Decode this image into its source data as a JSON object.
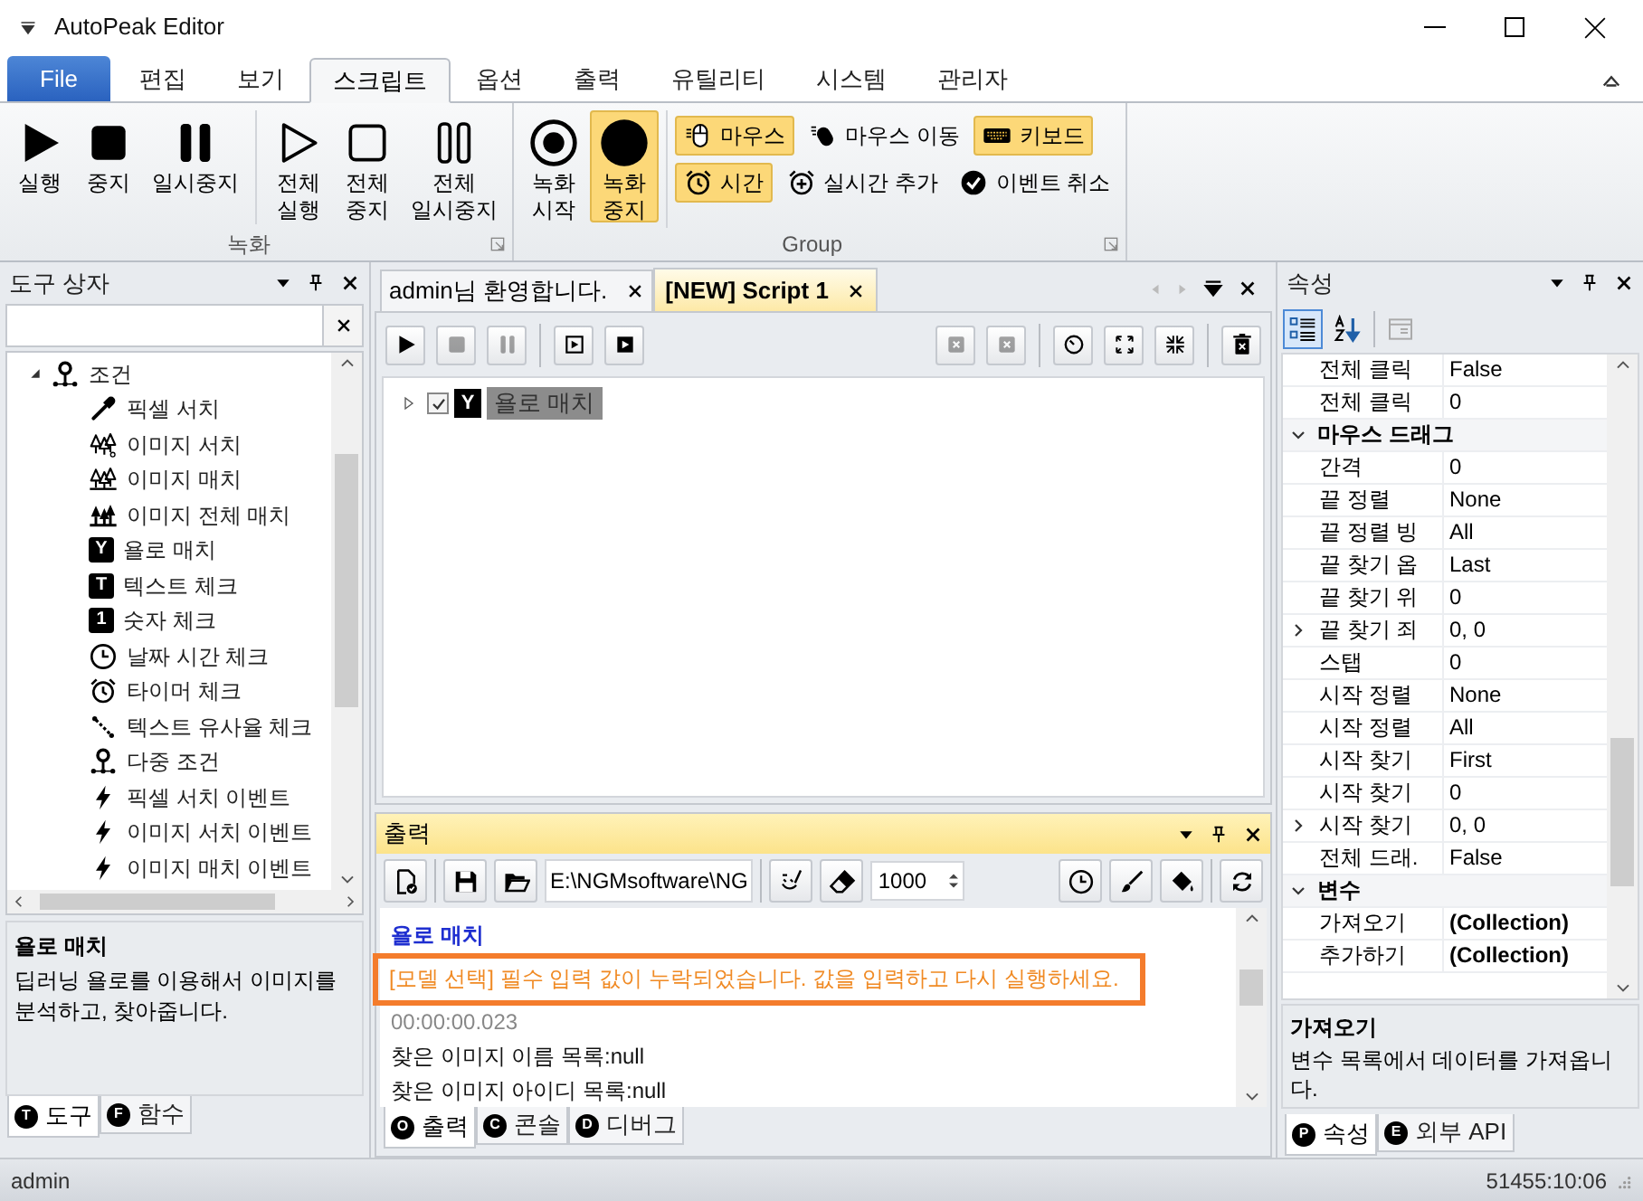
{
  "window": {
    "title": "AutoPeak Editor"
  },
  "menu_tabs": [
    {
      "label": "File",
      "kind": "file",
      "selected": false
    },
    {
      "label": "편집",
      "kind": "tab",
      "selected": false
    },
    {
      "label": "보기",
      "kind": "tab",
      "selected": false
    },
    {
      "label": "스크립트",
      "kind": "tab",
      "selected": true
    },
    {
      "label": "옵션",
      "kind": "tab",
      "selected": false
    },
    {
      "label": "출력",
      "kind": "tab",
      "selected": false
    },
    {
      "label": "유틸리티",
      "kind": "tab",
      "selected": false
    },
    {
      "label": "시스템",
      "kind": "tab",
      "selected": false
    },
    {
      "label": "관리자",
      "kind": "tab",
      "selected": false
    }
  ],
  "ribbon": {
    "groups": [
      {
        "title": "녹화",
        "big_buttons": [
          {
            "label": "실행",
            "kind": "play",
            "selected": false
          },
          {
            "label": "중지",
            "kind": "stop",
            "selected": false
          },
          {
            "label": "일시중지",
            "kind": "pause",
            "selected": false
          },
          {
            "label": "전체\n실행",
            "kind": "play-outline",
            "selected": false
          },
          {
            "label": "전체\n중지",
            "kind": "stop-outline",
            "selected": false
          },
          {
            "label": "전체\n일시중지",
            "kind": "pause-outline",
            "selected": false
          }
        ]
      },
      {
        "title": "Group",
        "big_buttons": [
          {
            "label": "녹화\n시작",
            "kind": "record",
            "selected": false
          },
          {
            "label": "녹화\n중지",
            "kind": "dot",
            "selected": true
          }
        ],
        "small_buttons": [
          {
            "label": "마우스",
            "kind": "mouse",
            "selected": true
          },
          {
            "label": "마우스 이동",
            "kind": "mouse-move",
            "selected": false
          },
          {
            "label": "키보드",
            "kind": "keyboard",
            "selected": true
          },
          {
            "label": "시간",
            "kind": "alarm",
            "selected": true
          },
          {
            "label": "실시간 추가",
            "kind": "alarm-plus",
            "selected": false
          },
          {
            "label": "이벤트 취소",
            "kind": "check",
            "selected": false
          }
        ]
      }
    ]
  },
  "toolbox": {
    "title": "도구 상자",
    "tree": [
      {
        "label": "조건",
        "kind": "pin",
        "expanded": true,
        "children": [
          {
            "label": "픽셀 서치",
            "kind": "dropper"
          },
          {
            "label": "이미지 서치",
            "kind": "trees"
          },
          {
            "label": "이미지 매치",
            "kind": "trees-base"
          },
          {
            "label": "이미지 전체 매치",
            "kind": "trees-fill"
          },
          {
            "label": "욜로 매치",
            "kind": "badge",
            "badge": "Y"
          },
          {
            "label": "텍스트 체크",
            "kind": "badge",
            "badge": "T"
          },
          {
            "label": "숫자 체크",
            "kind": "badge",
            "badge": "1"
          },
          {
            "label": "날짜 시간 체크",
            "kind": "clock"
          },
          {
            "label": "타이머 체크",
            "kind": "alarm"
          },
          {
            "label": "텍스트 유사율 체크",
            "kind": "similar"
          },
          {
            "label": "다중 조건",
            "kind": "pin"
          },
          {
            "label": "픽셀 서치 이벤트",
            "kind": "bolt"
          },
          {
            "label": "이미지 서치 이벤트",
            "kind": "bolt"
          },
          {
            "label": "이미지 매치 이벤트",
            "kind": "bolt"
          }
        ]
      }
    ],
    "description": {
      "title": "욜로 매치",
      "text": "딥러닝 욜로를 이용해서 이미지를 분석하고, 찾아줍니다."
    },
    "tabs": [
      {
        "label": "도구",
        "badge": "T",
        "selected": true
      },
      {
        "label": "함수",
        "badge": "F",
        "selected": false
      }
    ]
  },
  "documents": {
    "tabs": [
      {
        "label": "admin님 환영합니다.",
        "selected": false
      },
      {
        "label": "[NEW] Script 1",
        "selected": true
      }
    ],
    "toolbar": [
      [
        {
          "kind": "play",
          "disabled": false
        },
        {
          "kind": "stop",
          "disabled": true
        },
        {
          "kind": "pause",
          "disabled": true
        }
      ],
      [
        {
          "kind": "step",
          "disabled": false
        },
        {
          "kind": "run-box",
          "disabled": false
        }
      ],
      [
        {
          "kind": "remove",
          "disabled": true
        },
        {
          "kind": "remove",
          "disabled": true
        }
      ],
      [
        {
          "kind": "reset",
          "disabled": false
        },
        {
          "kind": "expand",
          "disabled": false
        },
        {
          "kind": "collapse",
          "disabled": false
        }
      ],
      [
        {
          "kind": "delete",
          "disabled": false
        }
      ]
    ],
    "script": [
      {
        "label": "욜로 매치",
        "badge": "Y",
        "checked": true,
        "expanded": false,
        "selected": true
      }
    ]
  },
  "output": {
    "title": "출력",
    "path": "E:\\NGMsoftware\\NG",
    "limit": "1000",
    "lines": [
      {
        "text": "욜로 매치",
        "kind": "info",
        "highlighted": false
      },
      {
        "text": "[모델 선택] 필수 입력 값이 누락되었습니다. 값을 입력하고 다시 실행하세요.",
        "kind": "error",
        "highlighted": true
      },
      {
        "text": "00:00:00.023",
        "kind": "time",
        "highlighted": false
      },
      {
        "text": "찾은 이미지 이름 목록:null",
        "kind": "plain",
        "highlighted": false
      },
      {
        "text": "찾은 이미지 아이디 목록:null",
        "kind": "plain",
        "highlighted": false
      }
    ],
    "tabs": [
      {
        "label": "출력",
        "badge": "O",
        "selected": true
      },
      {
        "label": "콘솔",
        "badge": "C",
        "selected": false
      },
      {
        "label": "디버그",
        "badge": "D",
        "selected": false
      }
    ]
  },
  "properties": {
    "title": "속성",
    "toolbar": [
      {
        "kind": "categorized",
        "selected": true
      },
      {
        "kind": "alphabetical",
        "selected": false
      },
      {
        "kind": "pages",
        "selected": false
      }
    ],
    "rows": [
      {
        "kind": "property",
        "name": "전체 클릭",
        "value": "False"
      },
      {
        "kind": "property",
        "name": "전체 클릭",
        "value": "0"
      },
      {
        "kind": "category",
        "name": "마우스 드래그",
        "expanded": true
      },
      {
        "kind": "property",
        "name": "간격",
        "value": "0"
      },
      {
        "kind": "property",
        "name": "끝 정렬",
        "value": "None"
      },
      {
        "kind": "property",
        "name": "끝 정렬 빙",
        "value": "All"
      },
      {
        "kind": "property",
        "name": "끝 찾기 옵",
        "value": "Last"
      },
      {
        "kind": "property",
        "name": "끝 찾기 위",
        "value": "0"
      },
      {
        "kind": "property",
        "name": "끝 찾기 죄",
        "value": "0, 0",
        "expanded": false
      },
      {
        "kind": "property",
        "name": "스탭",
        "value": "0"
      },
      {
        "kind": "property",
        "name": "시작 정렬",
        "value": "None"
      },
      {
        "kind": "property",
        "name": "시작 정렬",
        "value": "All"
      },
      {
        "kind": "property",
        "name": "시작 찾기",
        "value": "First"
      },
      {
        "kind": "property",
        "name": "시작 찾기",
        "value": "0"
      },
      {
        "kind": "property",
        "name": "시작 찾기",
        "value": "0, 0",
        "expanded": false
      },
      {
        "kind": "property",
        "name": "전체 드래.",
        "value": "False"
      },
      {
        "kind": "category",
        "name": "변수",
        "expanded": true
      },
      {
        "kind": "property",
        "name": "가져오기",
        "value": "(Collection)",
        "bold": true
      },
      {
        "kind": "property",
        "name": "추가하기",
        "value": "(Collection)",
        "bold": true
      }
    ],
    "description": {
      "title": "가져오기",
      "text": "변수 목록에서 데이터를 가져옵니다."
    },
    "tabs": [
      {
        "label": "속성",
        "badge": "P",
        "selected": true
      },
      {
        "label": "외부 API",
        "badge": "E",
        "selected": false
      }
    ]
  },
  "status_bar": {
    "user": "admin",
    "position": "51455:10:06"
  }
}
